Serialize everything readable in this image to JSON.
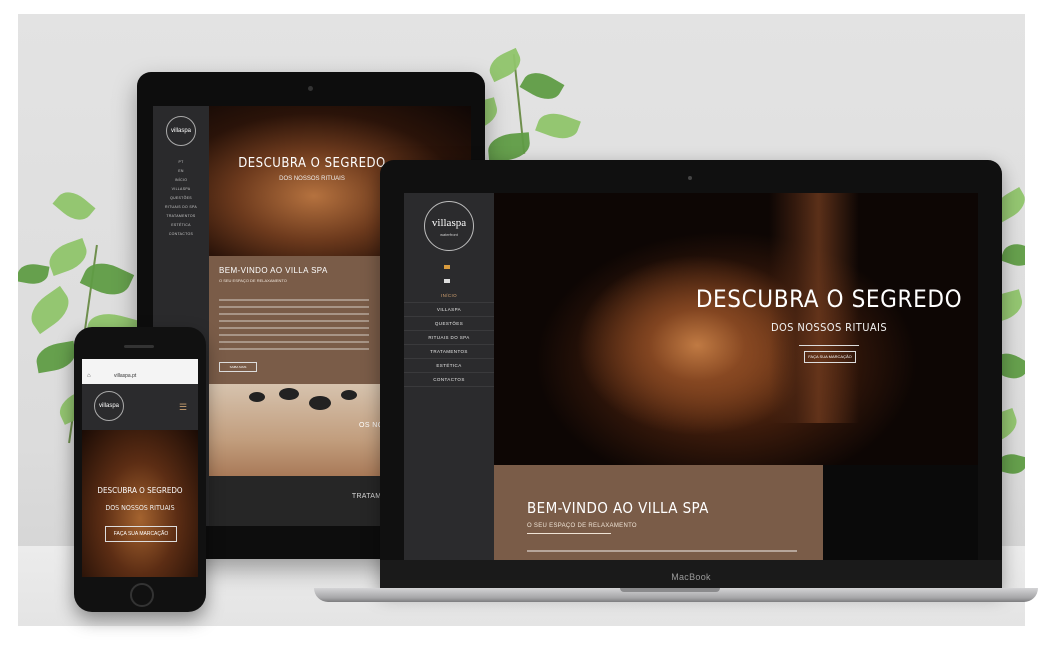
{
  "tablet": {
    "logo_text": "villaspa",
    "menu": [
      "PT",
      "EN",
      "INÍCIO",
      "VILLASPA",
      "QUESTÕES",
      "RITUAIS DO SPA",
      "TRATAMENTOS",
      "ESTÉTICA",
      "CONTACTOS"
    ],
    "hero_title": "DESCUBRA O SEGREDO",
    "hero_subtitle": "DOS NOSSOS RITUAIS",
    "welcome_title": "BEM-VINDO AO VILLA SPA",
    "welcome_subtitle": "O SEU ESPAÇO DE RELAXAMENTO",
    "cta": "SAIBA MAIS",
    "stones_title": "OS NOSSOS RITUAIS",
    "bottom_title": "TRATAMENTOS DE CORPO & ROSTO"
  },
  "laptop": {
    "logo_text": "villaspa",
    "logo_sub": "waterfront",
    "menu": [
      "INÍCIO",
      "VILLASPA",
      "QUESTÕES",
      "RITUAIS DO SPA",
      "TRATAMENTOS",
      "ESTÉTICA",
      "CONTACTOS"
    ],
    "hero_title": "DESCUBRA O SEGREDO",
    "hero_subtitle": "DOS NOSSOS RITUAIS",
    "hero_button": "FAÇA SUA MARCAÇÃO",
    "welcome_title": "BEM-VINDO AO VILLA SPA",
    "welcome_subtitle": "O SEU ESPAÇO DE RELAXAMENTO",
    "brand": "MacBook"
  },
  "phone": {
    "url": "villaspa.pt",
    "logo_text": "villaspa",
    "hero_title": "DESCUBRA O SEGREDO",
    "hero_subtitle": "DOS NOSSOS RITUAIS",
    "hero_button": "FAÇA SUA MARCAÇÃO"
  },
  "icons": {
    "phone_menu": "hamburger-menu-icon",
    "phone_lock": "lock-icon"
  },
  "colors": {
    "brown_panel": "#7a5c48",
    "sidebar": "#2b2b2d",
    "accent": "#d0a070"
  }
}
